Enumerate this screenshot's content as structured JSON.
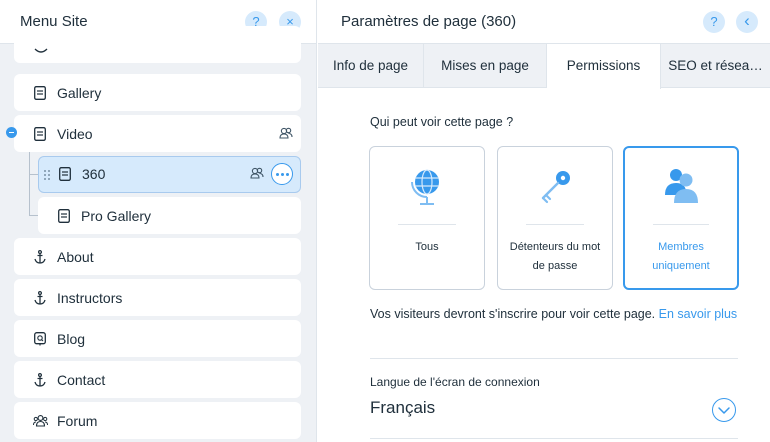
{
  "site_menu": {
    "title": "Menu Site",
    "help_label": "?",
    "close_label": "×",
    "items": [
      {
        "label": "Gallery",
        "icon": "page-icon"
      },
      {
        "label": "Video",
        "icon": "page-icon"
      },
      {
        "label": "360",
        "icon": "page-icon"
      },
      {
        "label": "Pro Gallery",
        "icon": "page-icon"
      },
      {
        "label": "About",
        "icon": "anchor-icon"
      },
      {
        "label": "Instructors",
        "icon": "anchor-icon"
      },
      {
        "label": "Blog",
        "icon": "blog-icon"
      },
      {
        "label": "Contact",
        "icon": "anchor-icon"
      },
      {
        "label": "Forum",
        "icon": "forum-icon"
      }
    ]
  },
  "page_settings": {
    "title": "Paramètres de page (360)",
    "help_label": "?",
    "back_label": "‹",
    "tabs": [
      "Info de page",
      "Mises en page",
      "Permissions",
      "SEO et résea…"
    ],
    "active_tab": "Permissions",
    "question": "Qui peut voir cette page ?",
    "options": [
      {
        "label": "Tous",
        "icon": "globe-icon"
      },
      {
        "label": "Détenteurs du mot de passe",
        "icon": "key-icon"
      },
      {
        "label": "Membres uniquement",
        "icon": "members-icon"
      }
    ],
    "info_text": "Vos visiteurs devront s'inscrire pour voir cette page.",
    "info_link": "En savoir plus",
    "language_label": "Langue de l'écran de connexion",
    "language_value": "Français"
  },
  "colors": {
    "accent": "#3899ec",
    "accent_light": "#d6eafc",
    "panel_bg": "#eef1f5",
    "text": "#20303c"
  }
}
